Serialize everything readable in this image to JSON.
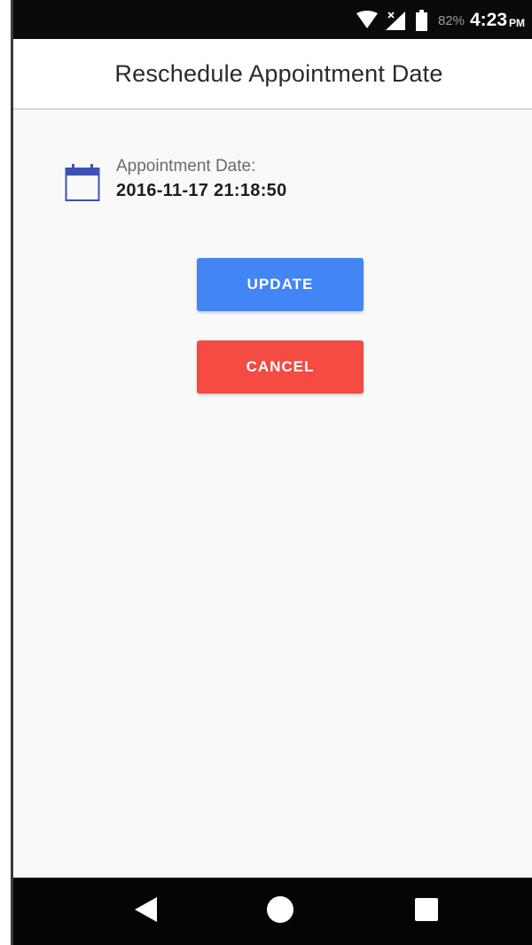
{
  "status_bar": {
    "battery_percent": "82%",
    "time": "4:23",
    "time_suffix": "PM",
    "icons": [
      "wifi-icon",
      "signal-icon",
      "battery-icon"
    ]
  },
  "app_bar": {
    "title": "Reschedule Appointment Date"
  },
  "appointment": {
    "icon": "calendar-icon",
    "label": "Appointment Date:",
    "value": "2016-11-17 21:18:50"
  },
  "actions": {
    "update_label": "UPDATE",
    "cancel_label": "CANCEL"
  },
  "nav_bar": {
    "icons": [
      "back-icon",
      "home-icon",
      "recents-icon"
    ]
  },
  "colors": {
    "update": "#4285f4",
    "cancel": "#f44b43",
    "calendar": "#3f51b5"
  }
}
